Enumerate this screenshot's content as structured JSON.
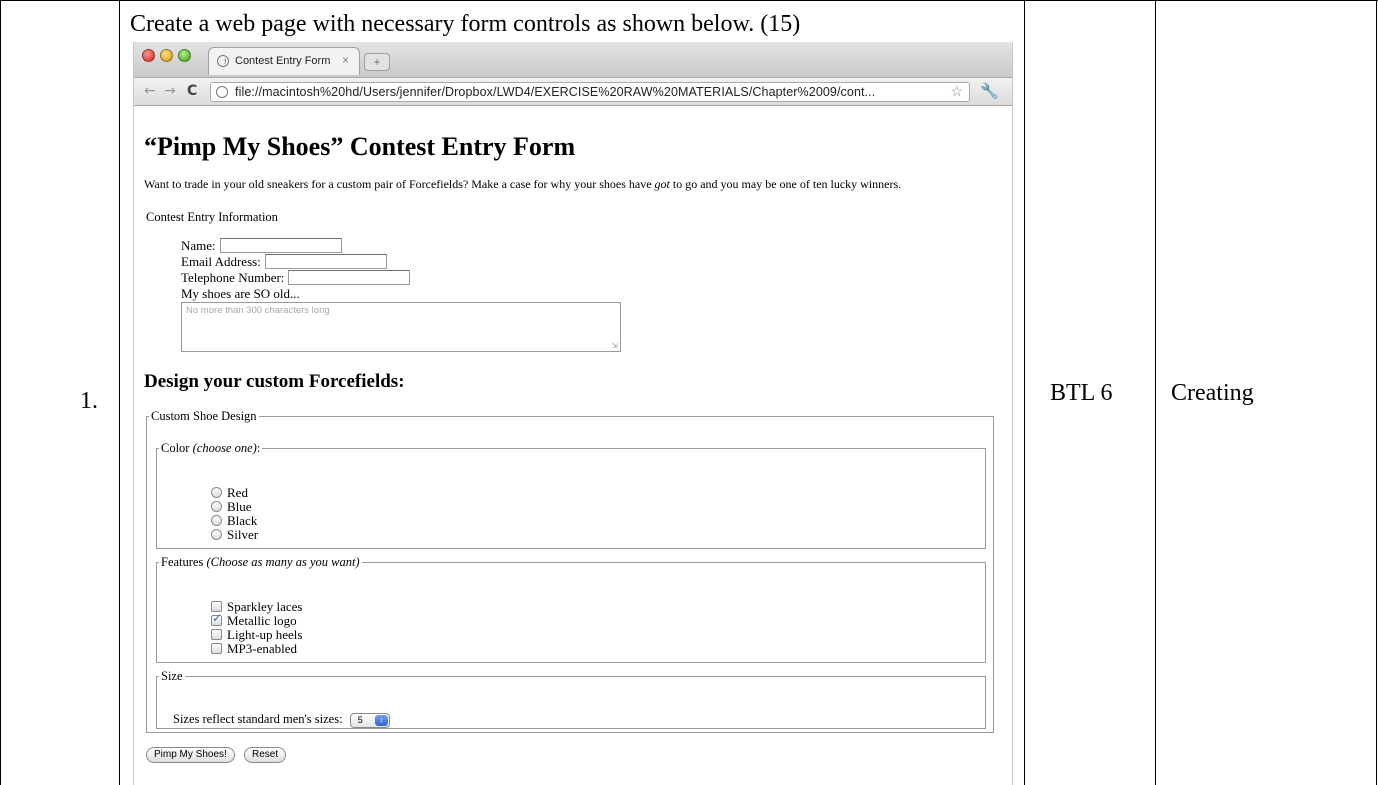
{
  "document": {
    "question": "Create a web page with necessary form controls as shown below. (15)",
    "number": "1.",
    "btl": "BTL 6",
    "level": "Creating"
  },
  "browser": {
    "tab_title": "Contest Entry Form",
    "tab_close": "×",
    "new_tab": "+",
    "url": "file://macintosh%20hd/Users/jennifer/Dropbox/LWD4/EXERCISE%20RAW%20MATERIALS/Chapter%2009/cont...",
    "colors": {
      "close": "#e0443c",
      "minimize": "#e4a92d",
      "maximize": "#5bb635",
      "reload": "#444444"
    }
  },
  "form_page": {
    "title": "“Pimp My Shoes” Contest Entry Form",
    "intro_before": "Want to trade in your old sneakers for a custom pair of Forcefields? Make a case for why your shoes have ",
    "intro_emphasis": "got",
    "intro_after": " to go and you may be one of ten lucky winners.",
    "info_legend": "Contest Entry Information",
    "fields": {
      "name_label": "Name:",
      "email_label": "Email Address:",
      "telephone_label": "Telephone Number:",
      "old_label": "My shoes are SO old...",
      "textarea_placeholder": "No more than 300 characters long"
    },
    "design_heading": "Design your custom Forcefields:",
    "outer_legend": "Custom Shoe Design",
    "color": {
      "legend": "Color ",
      "legend_em": "(choose one)",
      "legend_after": ":",
      "options": [
        "Red",
        "Blue",
        "Black",
        "Silver"
      ]
    },
    "features": {
      "legend": "Features ",
      "legend_em": "(Choose as many as you want)",
      "options": [
        {
          "label": "Sparkley laces",
          "checked": false
        },
        {
          "label": "Metallic logo",
          "checked": true
        },
        {
          "label": "Light-up heels",
          "checked": false
        },
        {
          "label": "MP3-enabled",
          "checked": false
        }
      ]
    },
    "size": {
      "legend": "Size",
      "label": "Sizes reflect standard men's sizes:",
      "selected": "5"
    },
    "buttons": {
      "submit": "Pimp My Shoes!",
      "reset": "Reset"
    }
  }
}
